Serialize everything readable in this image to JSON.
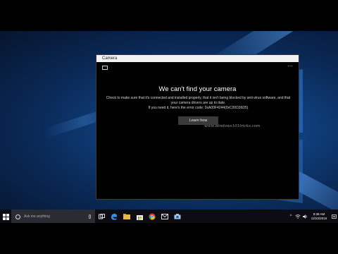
{
  "window": {
    "title": "Camera",
    "more_label": "···"
  },
  "message": {
    "title": "We can't find your camera",
    "line1": "Check to make sure that it's connected and installed properly, that it isn't being blocked by anti-virus software, and that",
    "line2": "your camera drivers are up to date.",
    "line3": "If you need it, here's the error code: 0xA00F4244(0xC00D36D5)",
    "button_label": "Learn how"
  },
  "watermark": "www.windows101tricks.com",
  "taskbar": {
    "search_placeholder": "Ask me anything",
    "pinned_icons": [
      "task-view-icon",
      "edge-icon",
      "file-explorer-icon",
      "store-icon",
      "chrome-icon",
      "mail-icon",
      "camera-app-icon"
    ],
    "tray_up_arrow": "^",
    "time": "9:38 AM",
    "date": "12/22/2016"
  },
  "colors": {
    "accent": "#7fb2ef",
    "taskbar": "#0c0c12",
    "desktop": "#10407f"
  }
}
